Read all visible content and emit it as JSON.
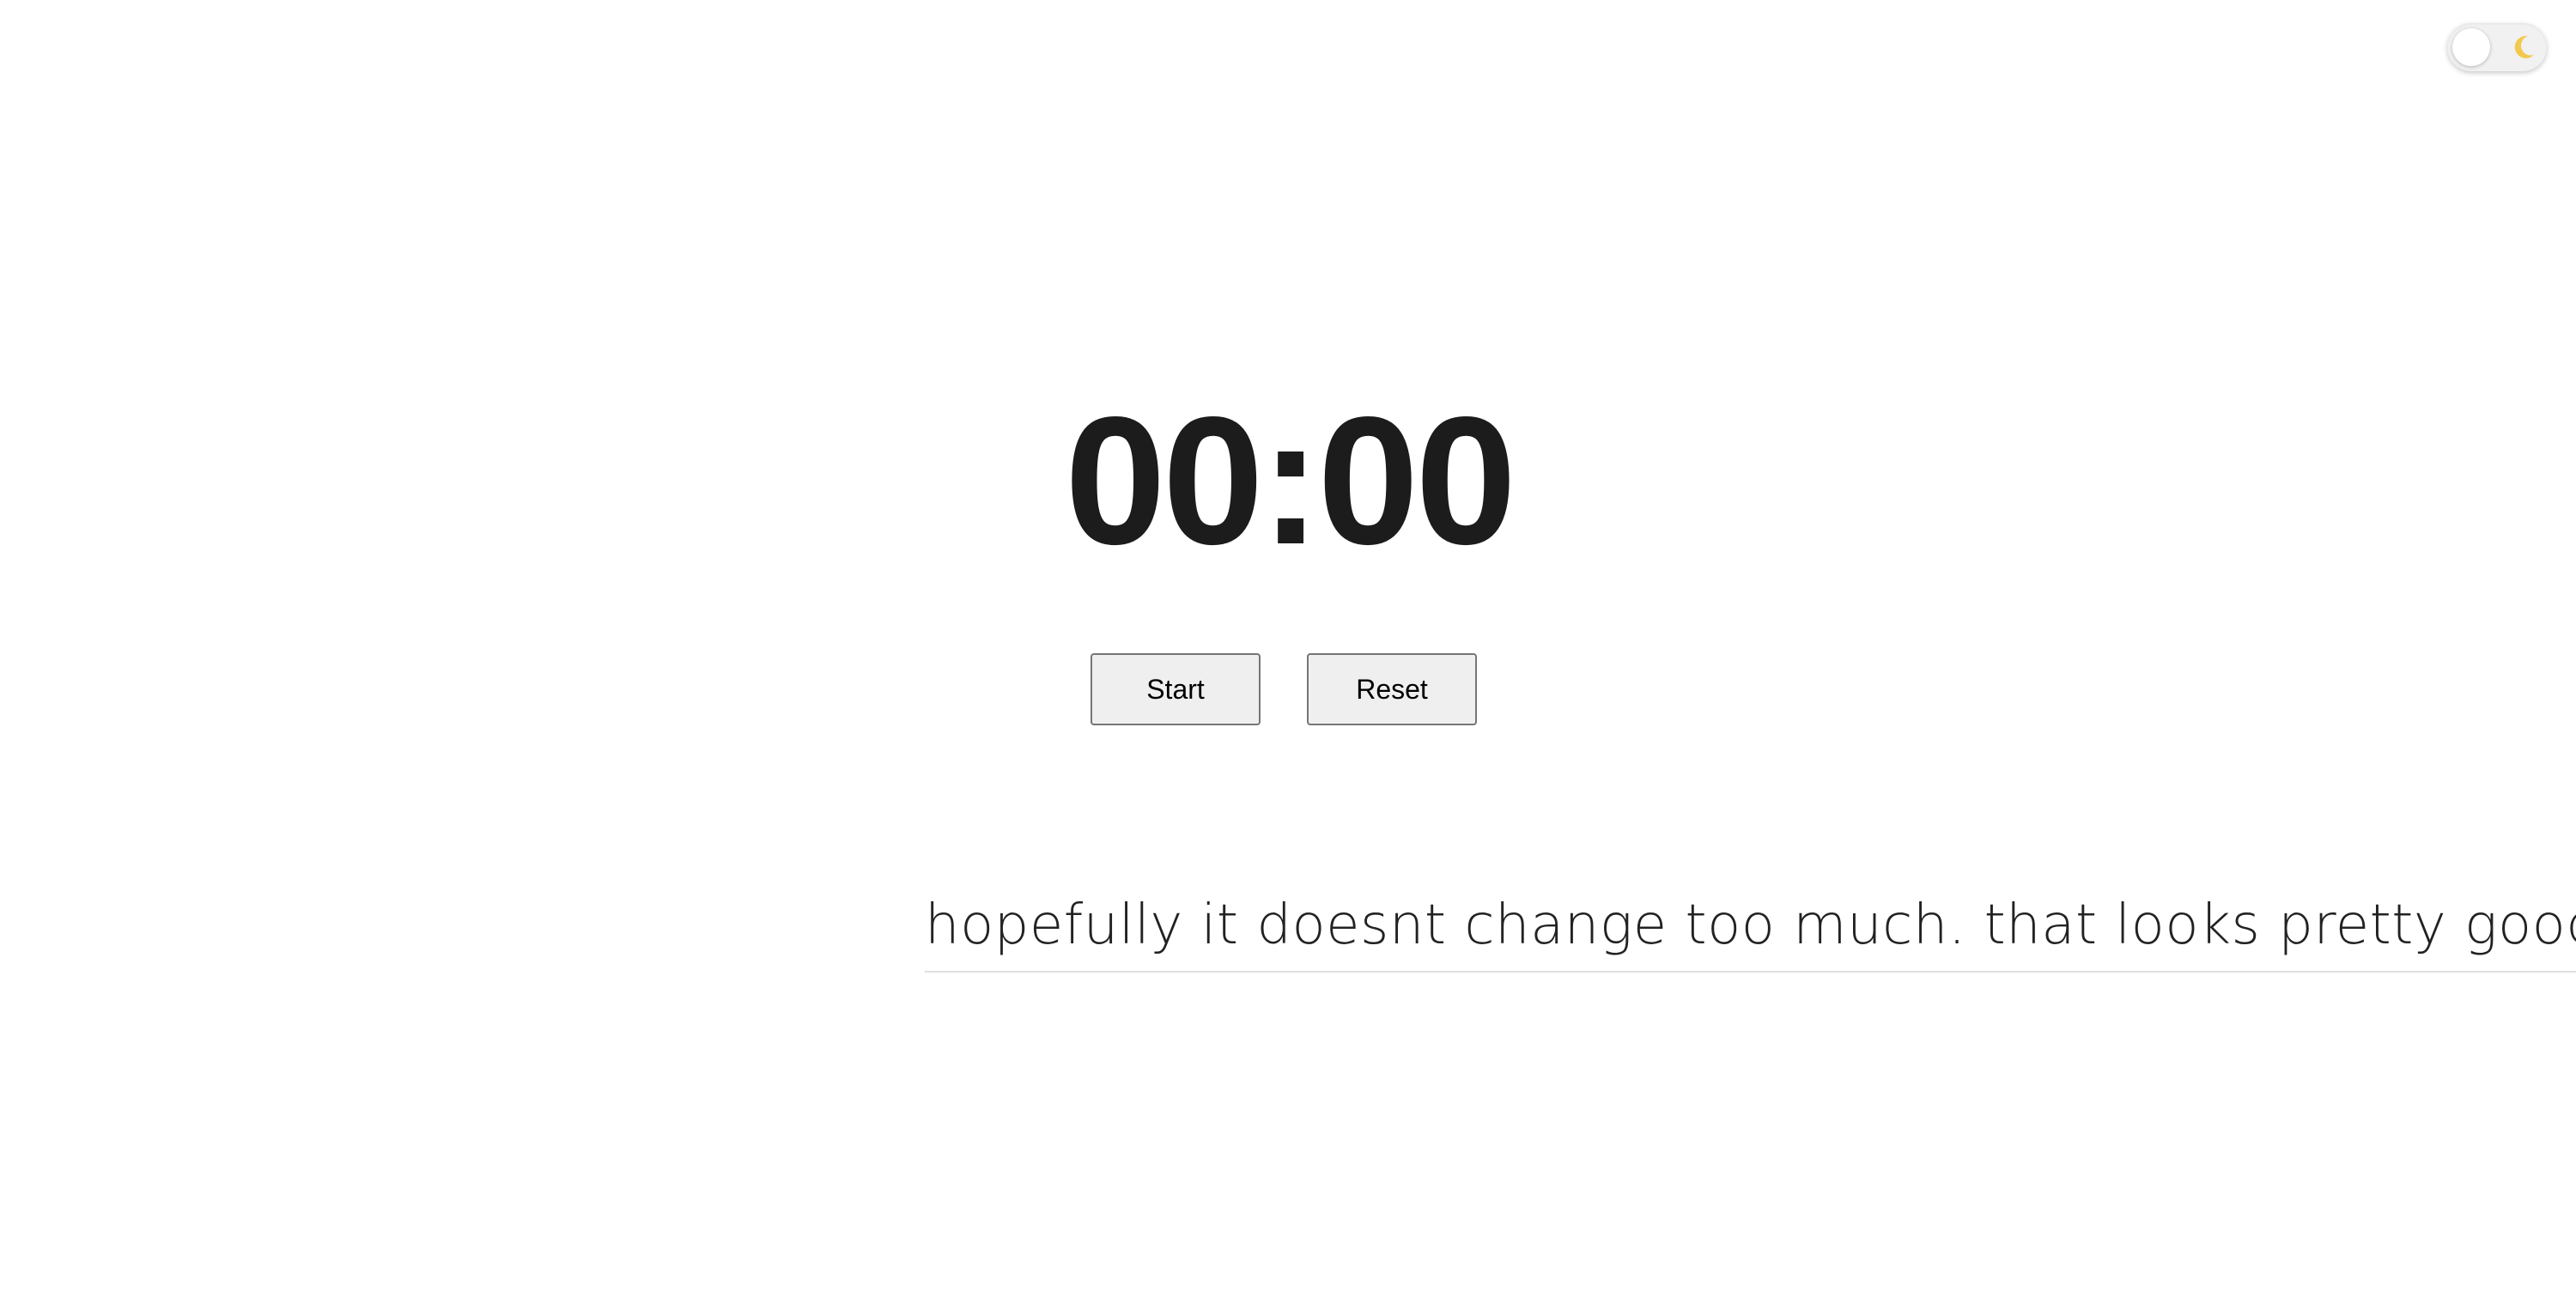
{
  "theme_toggle": {
    "icon": "moon-icon",
    "state": "off"
  },
  "timer": {
    "display": "00:00"
  },
  "controls": {
    "start_label": "Start",
    "reset_label": "Reset"
  },
  "text": {
    "content": "hopefully it doesnt change too much. that looks pretty good. what happened"
  },
  "colors": {
    "background": "#ffffff",
    "timer_text": "#1c1c1c",
    "button_bg": "#efefef",
    "moon": "#f2c94c"
  }
}
